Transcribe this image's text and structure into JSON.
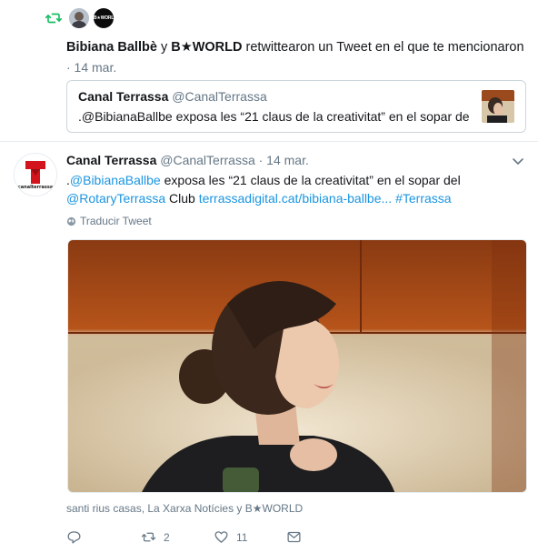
{
  "notification": {
    "user1": "Bibiana Ballbè",
    "connector": " y ",
    "user2": "B★WORLD",
    "action": " retwittearon un Tweet en el que te mencionaron",
    "time": "· 14 mar.",
    "icon": "retweet-icon",
    "avatar2_text": "B★WORLD",
    "accent_color": "#17bf63"
  },
  "quoted": {
    "name": "Canal Terrassa",
    "handle": "@CanalTerrassa",
    "text": ".@BibianaBallbe exposa les “21 claus de la creativitat” en el sopar de..."
  },
  "tweet": {
    "name": "Canal Terrassa",
    "handle": "@CanalTerrassa",
    "time": "· 14 mar.",
    "text_prefix": ".",
    "mention1": "@BibianaBallbe",
    "text_mid": " exposa les “21 claus de la creativitat” en el sopar del ",
    "mention2": "@RotaryTerrassa",
    "text_club": " Club ",
    "url": "terrassadigital.cat/bibiana-ballbe...",
    "space": " ",
    "hashtag": "#Terrassa",
    "translate": "Traducir Tweet",
    "avatar_brand": "canalterrassa",
    "link_color": "#1b95e0"
  },
  "liked_by": "santi rius casas, La Xarxa Notícies y B★WORLD",
  "actions": {
    "reply_count": "",
    "retweet_count": "2",
    "like_count": "11"
  }
}
